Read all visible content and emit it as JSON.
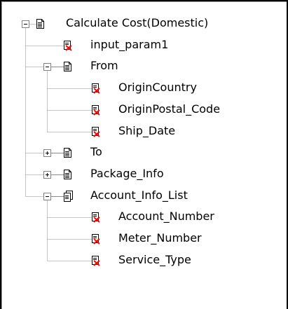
{
  "tree": {
    "nodes": [
      {
        "id": "calc",
        "label": "Calculate Cost(Domestic)",
        "depth": 0,
        "toggle": "minus",
        "icon": "document-icon"
      },
      {
        "id": "input_param1",
        "label": "input_param1",
        "depth": 1,
        "toggle": "none",
        "icon": "parameter-icon"
      },
      {
        "id": "from",
        "label": "From",
        "depth": 1,
        "toggle": "minus",
        "icon": "document-icon"
      },
      {
        "id": "origin_country",
        "label": "OriginCountry",
        "depth": 2,
        "toggle": "none",
        "icon": "parameter-icon"
      },
      {
        "id": "origin_postal",
        "label": "OriginPostal_Code",
        "depth": 2,
        "toggle": "none",
        "icon": "parameter-icon"
      },
      {
        "id": "ship_date",
        "label": "Ship_Date",
        "depth": 2,
        "toggle": "none",
        "icon": "parameter-icon"
      },
      {
        "id": "to",
        "label": "To",
        "depth": 1,
        "toggle": "plus",
        "icon": "document-icon"
      },
      {
        "id": "package_info",
        "label": "Package_Info",
        "depth": 1,
        "toggle": "plus",
        "icon": "document-icon"
      },
      {
        "id": "account_info_list",
        "label": "Account_Info_List",
        "depth": 1,
        "toggle": "minus",
        "icon": "document-list-icon"
      },
      {
        "id": "account_number",
        "label": "Account_Number",
        "depth": 2,
        "toggle": "none",
        "icon": "parameter-icon"
      },
      {
        "id": "meter_number",
        "label": "Meter_Number",
        "depth": 2,
        "toggle": "none",
        "icon": "parameter-icon"
      },
      {
        "id": "service_type",
        "label": "Service_Type",
        "depth": 2,
        "toggle": "none",
        "icon": "parameter-icon"
      }
    ]
  },
  "colors": {
    "text": "#000000",
    "frame": "#000000",
    "icon_red": "#ff0000",
    "connector": "#8c8c8c"
  }
}
